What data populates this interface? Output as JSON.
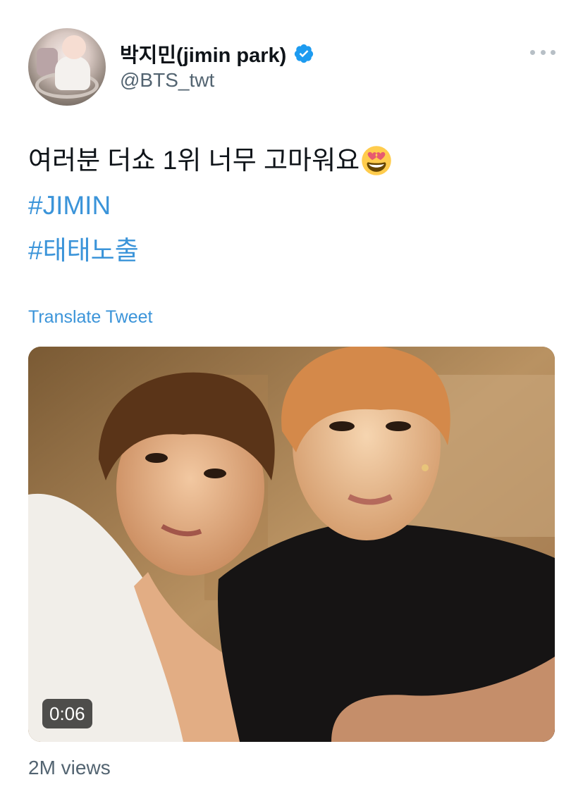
{
  "author": {
    "display_name": "박지민(jimin park)",
    "handle": "@BTS_twt",
    "verified": true
  },
  "icons": {
    "verified": "verified-badge-icon",
    "more": "more-options-icon",
    "emoji": "smiling-face-with-heart-eyes"
  },
  "tweet": {
    "text_line": "여러분 더쇼 1위 너무 고마워요",
    "hashtags": [
      "#JIMIN",
      "#태태노출"
    ]
  },
  "translate_label": "Translate Tweet",
  "media": {
    "duration": "0:06"
  },
  "views": "2M views",
  "colors": {
    "link": "#3b94d9",
    "verified_badge": "#1d9bf0",
    "secondary_text": "#536471",
    "primary_text": "#0f1419"
  }
}
